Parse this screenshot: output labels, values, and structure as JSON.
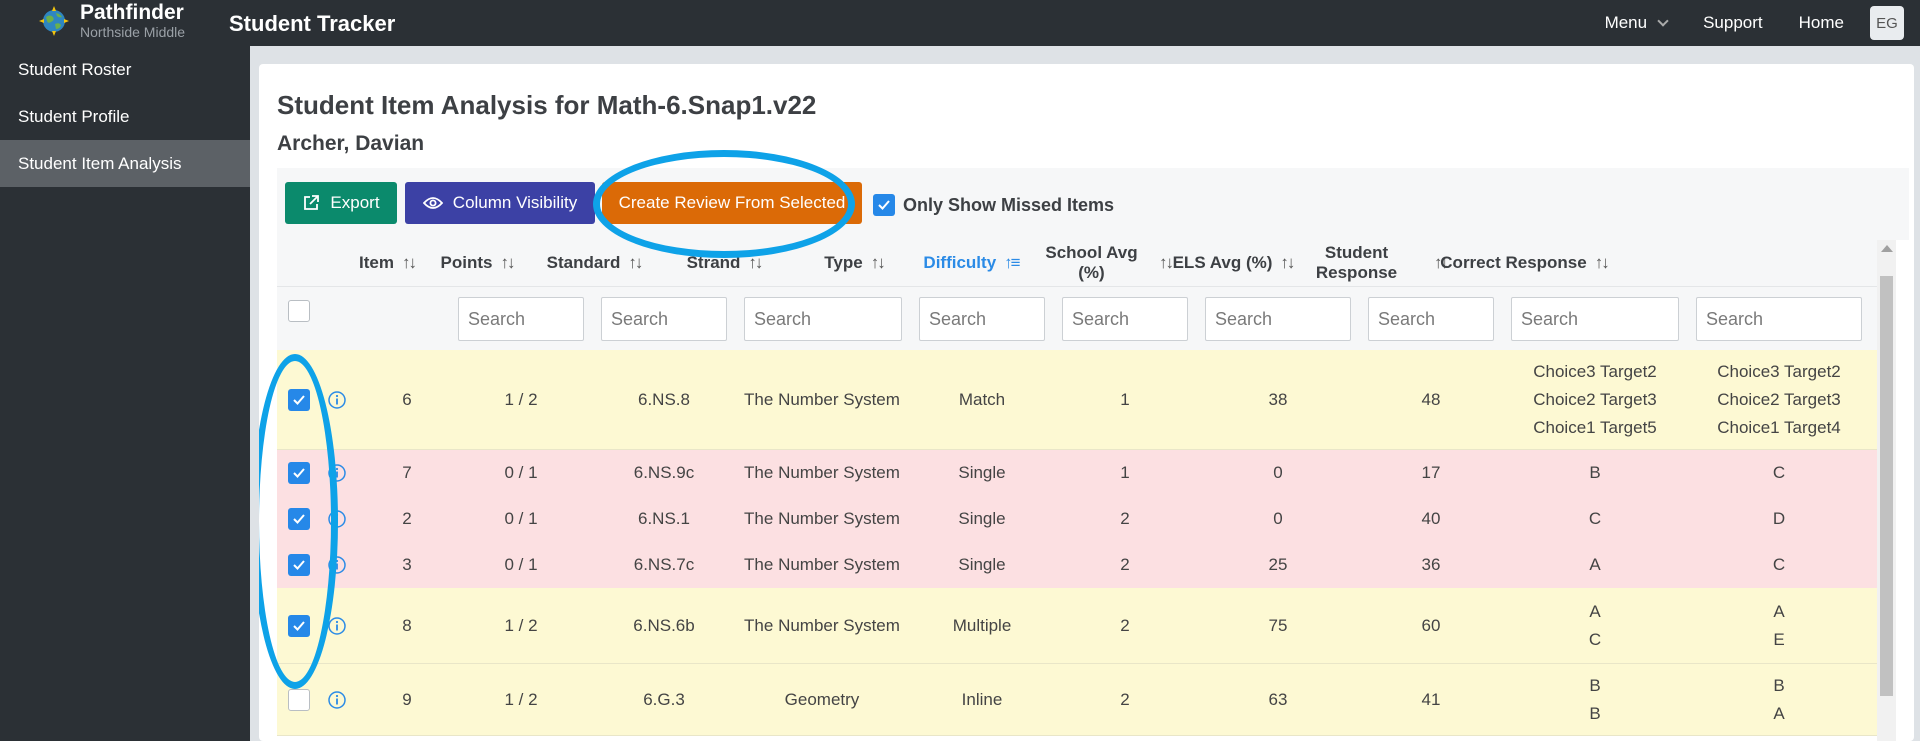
{
  "navbar": {
    "brand_name": "Pathfinder",
    "brand_sub": "Northside Middle",
    "app_title": "Student Tracker",
    "menu_label": "Menu",
    "support_label": "Support",
    "home_label": "Home",
    "user_initials": "EG"
  },
  "sidebar": {
    "items": [
      {
        "label": "Student Roster"
      },
      {
        "label": "Student Profile"
      },
      {
        "label": "Student Item Analysis"
      }
    ]
  },
  "page": {
    "title": "Student Item Analysis for Math-6.Snap1.v22",
    "student_name": "Archer, Davian"
  },
  "toolbar": {
    "export_label": "Export",
    "column_visibility_label": "Column Visibility",
    "create_review_label": "Create Review From Selected",
    "only_missed_label": "Only Show Missed Items",
    "only_missed_checked": true
  },
  "table": {
    "headers": [
      "Item",
      "Points",
      "Standard",
      "Strand",
      "Type",
      "Difficulty",
      "School Avg (%)",
      "ELS Avg (%)",
      "Student Response",
      "Correct Response"
    ],
    "sorted_column": "Difficulty",
    "search_placeholder": "Search",
    "rows": [
      {
        "checked": true,
        "item": "6",
        "points": "1 / 2",
        "standard": "6.NS.8",
        "strand": "The Number System",
        "type": "Match",
        "difficulty": "1",
        "school_avg": "38",
        "els_avg": "48",
        "student_response": [
          "Choice3 Target2",
          "Choice2 Target3",
          "Choice1 Target5"
        ],
        "correct_response": [
          "Choice3 Target2",
          "Choice2 Target3",
          "Choice1 Target4"
        ],
        "status": "partial"
      },
      {
        "checked": true,
        "item": "7",
        "points": "0 / 1",
        "standard": "6.NS.9c",
        "strand": "The Number System",
        "type": "Single",
        "difficulty": "1",
        "school_avg": "0",
        "els_avg": "17",
        "student_response": [
          "B"
        ],
        "correct_response": [
          "C"
        ],
        "status": "incorrect"
      },
      {
        "checked": true,
        "item": "2",
        "points": "0 / 1",
        "standard": "6.NS.1",
        "strand": "The Number System",
        "type": "Single",
        "difficulty": "2",
        "school_avg": "0",
        "els_avg": "40",
        "student_response": [
          "C"
        ],
        "correct_response": [
          "D"
        ],
        "status": "incorrect"
      },
      {
        "checked": true,
        "item": "3",
        "points": "0 / 1",
        "standard": "6.NS.7c",
        "strand": "The Number System",
        "type": "Single",
        "difficulty": "2",
        "school_avg": "25",
        "els_avg": "36",
        "student_response": [
          "A"
        ],
        "correct_response": [
          "C"
        ],
        "status": "incorrect"
      },
      {
        "checked": true,
        "item": "8",
        "points": "1 / 2",
        "standard": "6.NS.6b",
        "strand": "The Number System",
        "type": "Multiple",
        "difficulty": "2",
        "school_avg": "75",
        "els_avg": "60",
        "student_response": [
          "A",
          "C"
        ],
        "correct_response": [
          "A",
          "E"
        ],
        "status": "partial"
      },
      {
        "checked": false,
        "item": "9",
        "points": "1 / 2",
        "standard": "6.G.3",
        "strand": "Geometry",
        "type": "Inline",
        "difficulty": "2",
        "school_avg": "63",
        "els_avg": "41",
        "student_response": [
          "B",
          "B"
        ],
        "correct_response": [
          "B",
          "A"
        ],
        "status": "partial"
      }
    ]
  },
  "colors": {
    "export": "#0b8a6c",
    "column_visibility": "#3c41a5",
    "create_review": "#db6a07",
    "partial_row": "#fdf9d3",
    "incorrect_row": "#fce0e2",
    "annotation": "#0ea2e8",
    "sorted_header": "#2b8be6"
  }
}
